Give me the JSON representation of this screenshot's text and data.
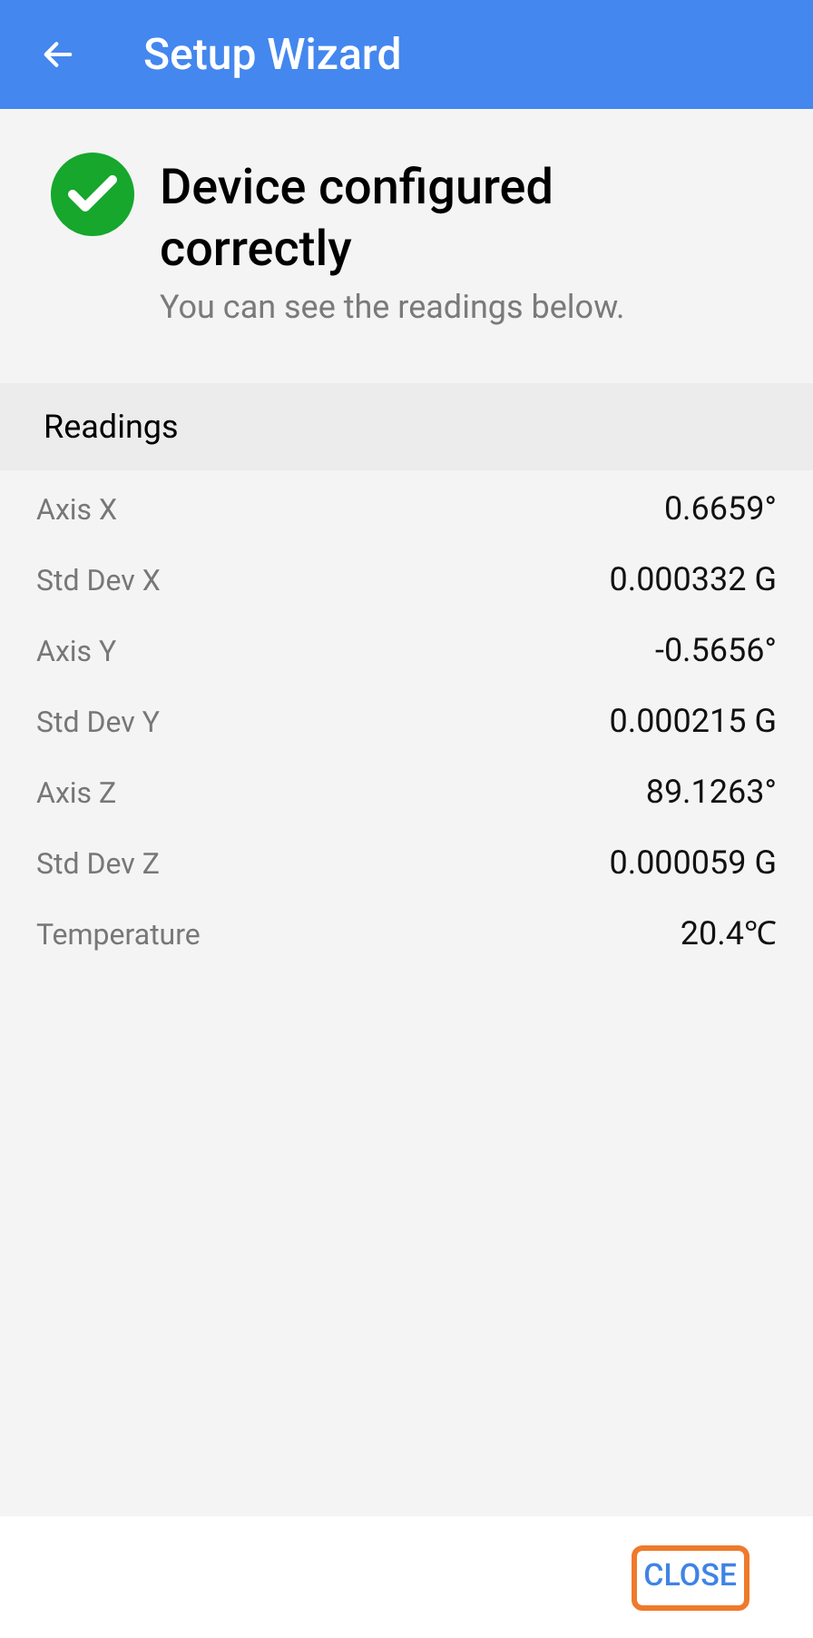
{
  "app_bar": {
    "title": "Setup Wizard"
  },
  "status": {
    "title": "Device configured correctly",
    "subtitle": "You can see the readings below."
  },
  "readings": {
    "header": "Readings",
    "rows": [
      {
        "label": "Axis X",
        "value": "0.6659°"
      },
      {
        "label": "Std Dev X",
        "value": "0.000332 G"
      },
      {
        "label": "Axis Y",
        "value": "-0.5656°"
      },
      {
        "label": "Std Dev Y",
        "value": "0.000215 G"
      },
      {
        "label": "Axis Z",
        "value": "89.1263°"
      },
      {
        "label": "Std Dev Z",
        "value": "0.000059 G"
      },
      {
        "label": "Temperature",
        "value": "20.4℃"
      }
    ]
  },
  "footer": {
    "button": {
      "label": "CLOSE",
      "highlighted": true
    }
  }
}
